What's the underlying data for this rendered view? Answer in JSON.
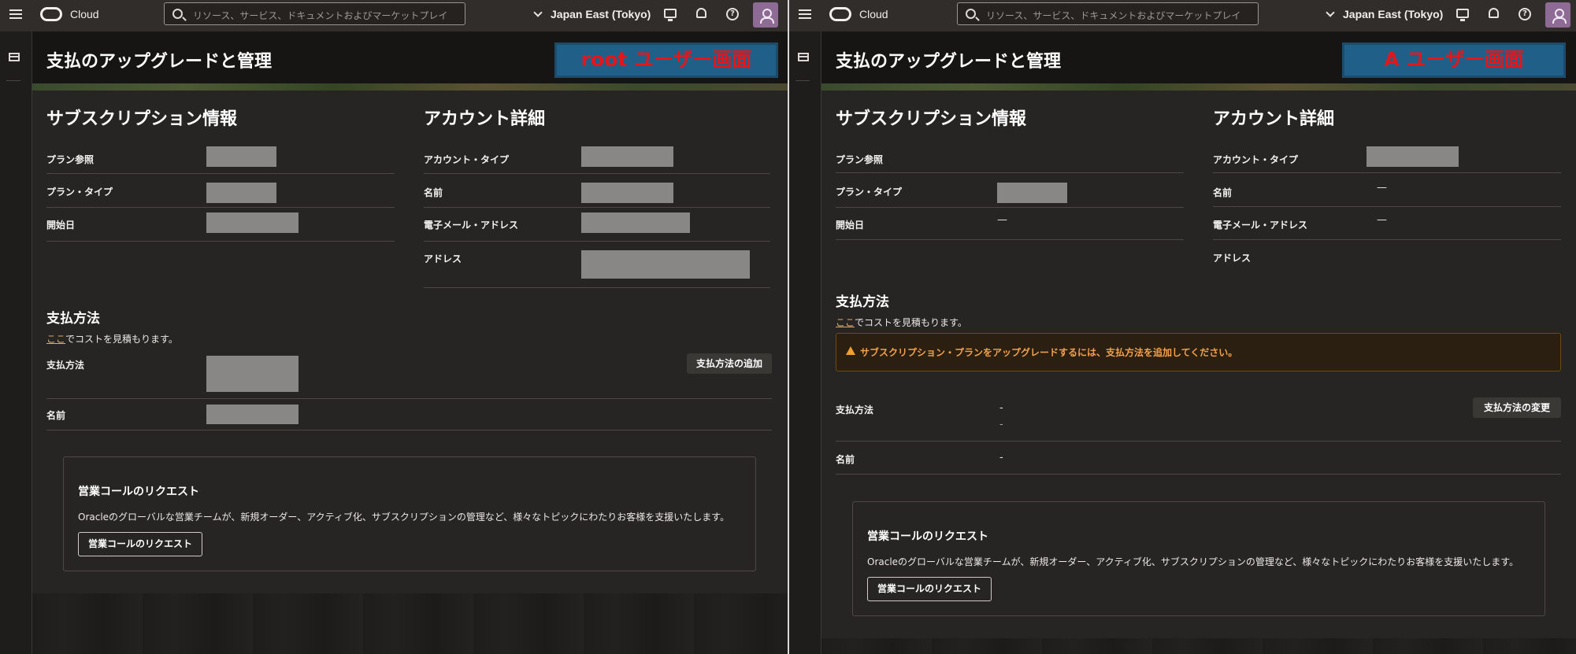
{
  "topbar": {
    "logo_text": "Cloud",
    "search_placeholder": "リソース、サービス、ドキュメントおよびマーケットプレイ",
    "region": "Japan East (Tokyo)"
  },
  "page": {
    "title": "支払のアップグレードと管理"
  },
  "panes": [
    {
      "banner": "root ユーザー画面",
      "subscription": {
        "title": "サブスクリプション情報",
        "rows": [
          {
            "label": "プラン参照"
          },
          {
            "label": "プラン・タイプ"
          },
          {
            "label": "開始日"
          }
        ]
      },
      "account": {
        "title": "アカウント詳細",
        "rows": [
          {
            "label": "アカウント・タイプ"
          },
          {
            "label": "名前"
          },
          {
            "label": "電子メール・アドレス"
          },
          {
            "label": "アドレス"
          }
        ]
      },
      "payment": {
        "title": "支払方法",
        "estimate_link": "ここ",
        "estimate_rest": "でコストを見積もります。",
        "button": "支払方法の追加",
        "rows": [
          {
            "label": "支払方法"
          },
          {
            "label": "名前"
          }
        ]
      },
      "sales": {
        "title": "営業コールのリクエスト",
        "desc": "Oracleのグローバルな営業チームが、新規オーダー、アクティブ化、サブスクリプションの管理など、様々なトピックにわたりお客様を支援いたします。",
        "button": "営業コールのリクエスト"
      }
    },
    {
      "banner": "A ユーザー画面",
      "subscription": {
        "title": "サブスクリプション情報",
        "rows": [
          {
            "label": "プラン参照",
            "value": ""
          },
          {
            "label": "プラン・タイプ"
          },
          {
            "label": "開始日",
            "value": "—"
          }
        ]
      },
      "account": {
        "title": "アカウント詳細",
        "rows": [
          {
            "label": "アカウント・タイプ"
          },
          {
            "label": "名前",
            "value": "—"
          },
          {
            "label": "電子メール・アドレス",
            "value": "—"
          },
          {
            "label": "アドレス",
            "value": ""
          }
        ]
      },
      "payment": {
        "title": "支払方法",
        "estimate_link": "ここ",
        "estimate_rest": "でコストを見積もります。",
        "warning": "サブスクリプション・プランをアップグレードするには、支払方法を追加してください。",
        "button": "支払方法の変更",
        "rows": [
          {
            "label": "支払方法",
            "value": "-",
            "value2": "-"
          },
          {
            "label": "名前",
            "value": "-"
          }
        ]
      },
      "sales": {
        "title": "営業コールのリクエスト",
        "desc": "Oracleのグローバルな営業チームが、新規オーダー、アクティブ化、サブスクリプションの管理など、様々なトピックにわたりお客様を支援いたします。",
        "button": "営業コールのリクエスト"
      }
    }
  ]
}
